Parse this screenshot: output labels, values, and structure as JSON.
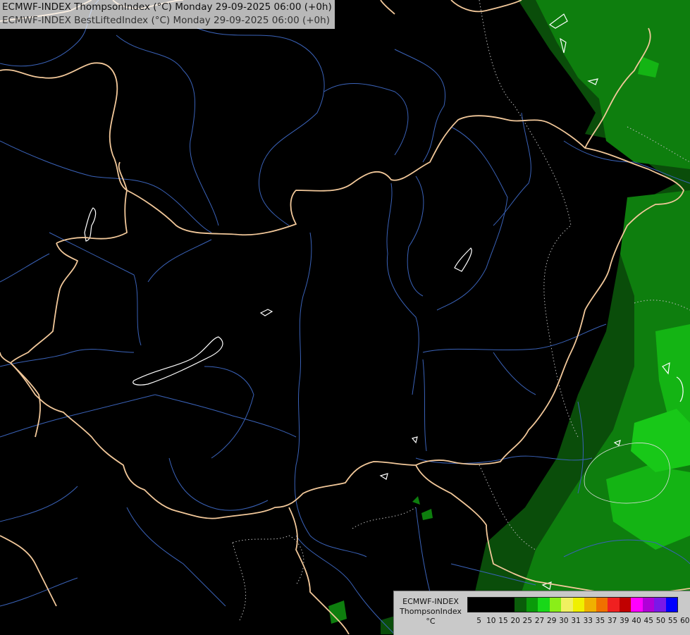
{
  "header": {
    "title_line1": "ECMWF-INDEX ThompsonIndex (°C) Monday 29-09-2025 06:00 (+0h)",
    "title_line2": "ECMWF-INDEX BestLiftedIndex (°C) Monday 29-09-2025 06:00 (+0h)"
  },
  "legend": {
    "model": "ECMWF-INDEX",
    "parameter": "ThompsonIndex",
    "unit": "°C",
    "ticks": [
      "5",
      "10",
      "15",
      "20",
      "25",
      "27",
      "29",
      "30",
      "31",
      "33",
      "35",
      "37",
      "39",
      "40",
      "45",
      "50",
      "55",
      "60"
    ],
    "colors": [
      "#000000",
      "#000000",
      "#000000",
      "#000000",
      "#0a5c0a",
      "#0a9a0a",
      "#18d818",
      "#8aee18",
      "#f0f060",
      "#f0f000",
      "#f0b000",
      "#f07000",
      "#f02020",
      "#c00000",
      "#ff00ff",
      "#b000d8",
      "#7a18e8",
      "#0000ff"
    ]
  },
  "colors": {
    "background": "#000000",
    "border": "#f2c89a",
    "river": "#3a62b8",
    "lake": "#ffffff",
    "green_dark": "#0a4d0a",
    "green_mid": "#0e7e0e",
    "green_bright": "#14b414"
  }
}
